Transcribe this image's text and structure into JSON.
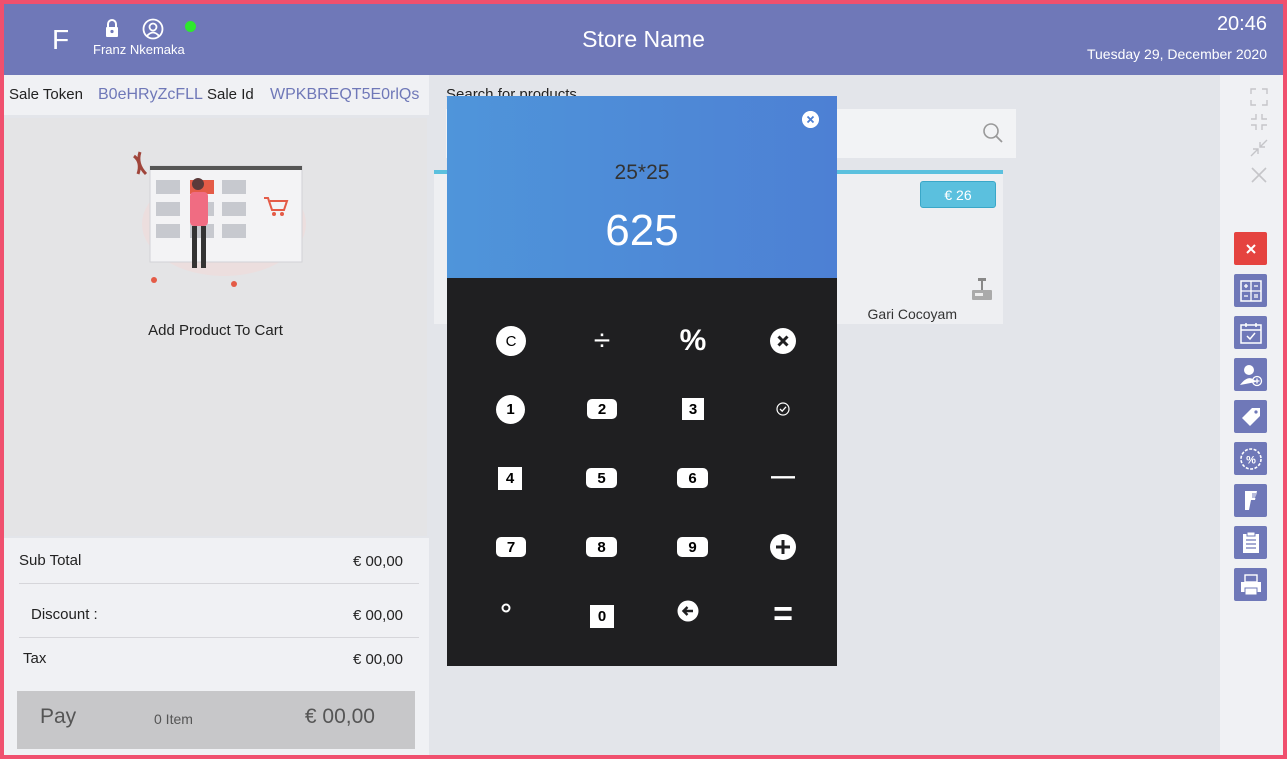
{
  "header": {
    "logo_letter": "F",
    "user_name": "Franz Nkemaka",
    "store_name": "Store Name",
    "time": "20:46",
    "date": "Tuesday 29, December  2020"
  },
  "sale": {
    "token_label": "Sale Token",
    "token_value": "B0eHRyZcFLL",
    "id_label": "Sale  Id",
    "id_value": "WPKBREQT5E0rlQs"
  },
  "cart": {
    "empty_text": "Add Product To Cart"
  },
  "totals": {
    "sub_total_label": "Sub Total",
    "sub_total_value": "€ 00,00",
    "discount_label": "Discount :",
    "discount_value": "€ 00,00",
    "tax_label": "Tax",
    "tax_value": "€ 00,00",
    "pay_label": "Pay",
    "item_count": "0 Item",
    "pay_amount": "€ 00,00"
  },
  "search": {
    "label": "Search for products"
  },
  "product": {
    "price": "€ 26",
    "name": "Gari Cocoyam"
  },
  "calculator": {
    "expression": "25*25",
    "result": "625",
    "keys": {
      "clear": "C",
      "divide": "÷",
      "percent": "%",
      "one": "1",
      "two": "2",
      "three": "3",
      "four": "4",
      "five": "5",
      "six": "6",
      "seven": "7",
      "eight": "8",
      "nine": "9",
      "zero": "0",
      "minus": "—",
      "equals": "="
    }
  },
  "colors": {
    "accent": "#6f78b8",
    "frame": "#f0506e",
    "badge": "#5bc0de",
    "danger": "#e5433f",
    "calc_pad": "#1f1f21"
  }
}
